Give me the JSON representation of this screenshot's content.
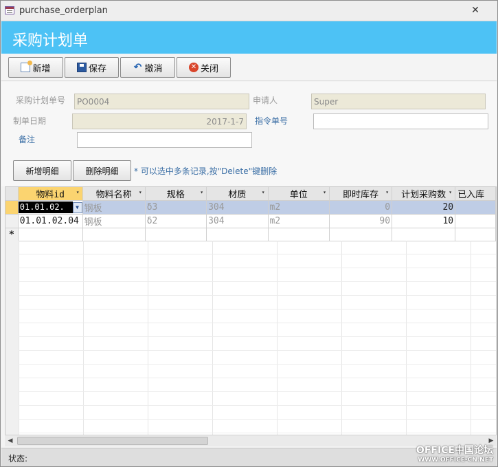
{
  "window": {
    "title": "purchase_orderplan",
    "close_glyph": "✕"
  },
  "header": {
    "title": "采购计划单"
  },
  "toolbar": {
    "new_label": "新增",
    "save_label": "保存",
    "undo_label": "撤消",
    "close_label": "关闭"
  },
  "form": {
    "plan_no_label": "采购计划单号",
    "plan_no_value": "PO0004",
    "applicant_label": "申请人",
    "applicant_value": "Super",
    "date_label": "制单日期",
    "date_value": "2017-1-7",
    "order_no_label": "指令单号",
    "order_no_value": "",
    "remark_label": "备注",
    "remark_value": ""
  },
  "detail": {
    "add_label": "新增明细",
    "delete_label": "删除明细",
    "hint": "* 可以选中多条记录,按\"Delete\"键删除"
  },
  "grid": {
    "columns": [
      "物料id",
      "物料名称",
      "规格",
      "材质",
      "单位",
      "即时库存",
      "计划采购数",
      "已入库"
    ],
    "rows": [
      [
        "01.01.02.",
        "钢板",
        "δ3",
        "304",
        "m2",
        "0",
        "20",
        ""
      ],
      [
        "01.01.02.04",
        "钢板",
        "δ2",
        "304",
        "m2",
        "90",
        "10",
        ""
      ]
    ],
    "new_row_marker": "*"
  },
  "status": {
    "label": "状态:"
  },
  "watermark": {
    "line1": "OFFICE中国论坛",
    "line2": "WWW.OFFICE-CN.NET"
  }
}
